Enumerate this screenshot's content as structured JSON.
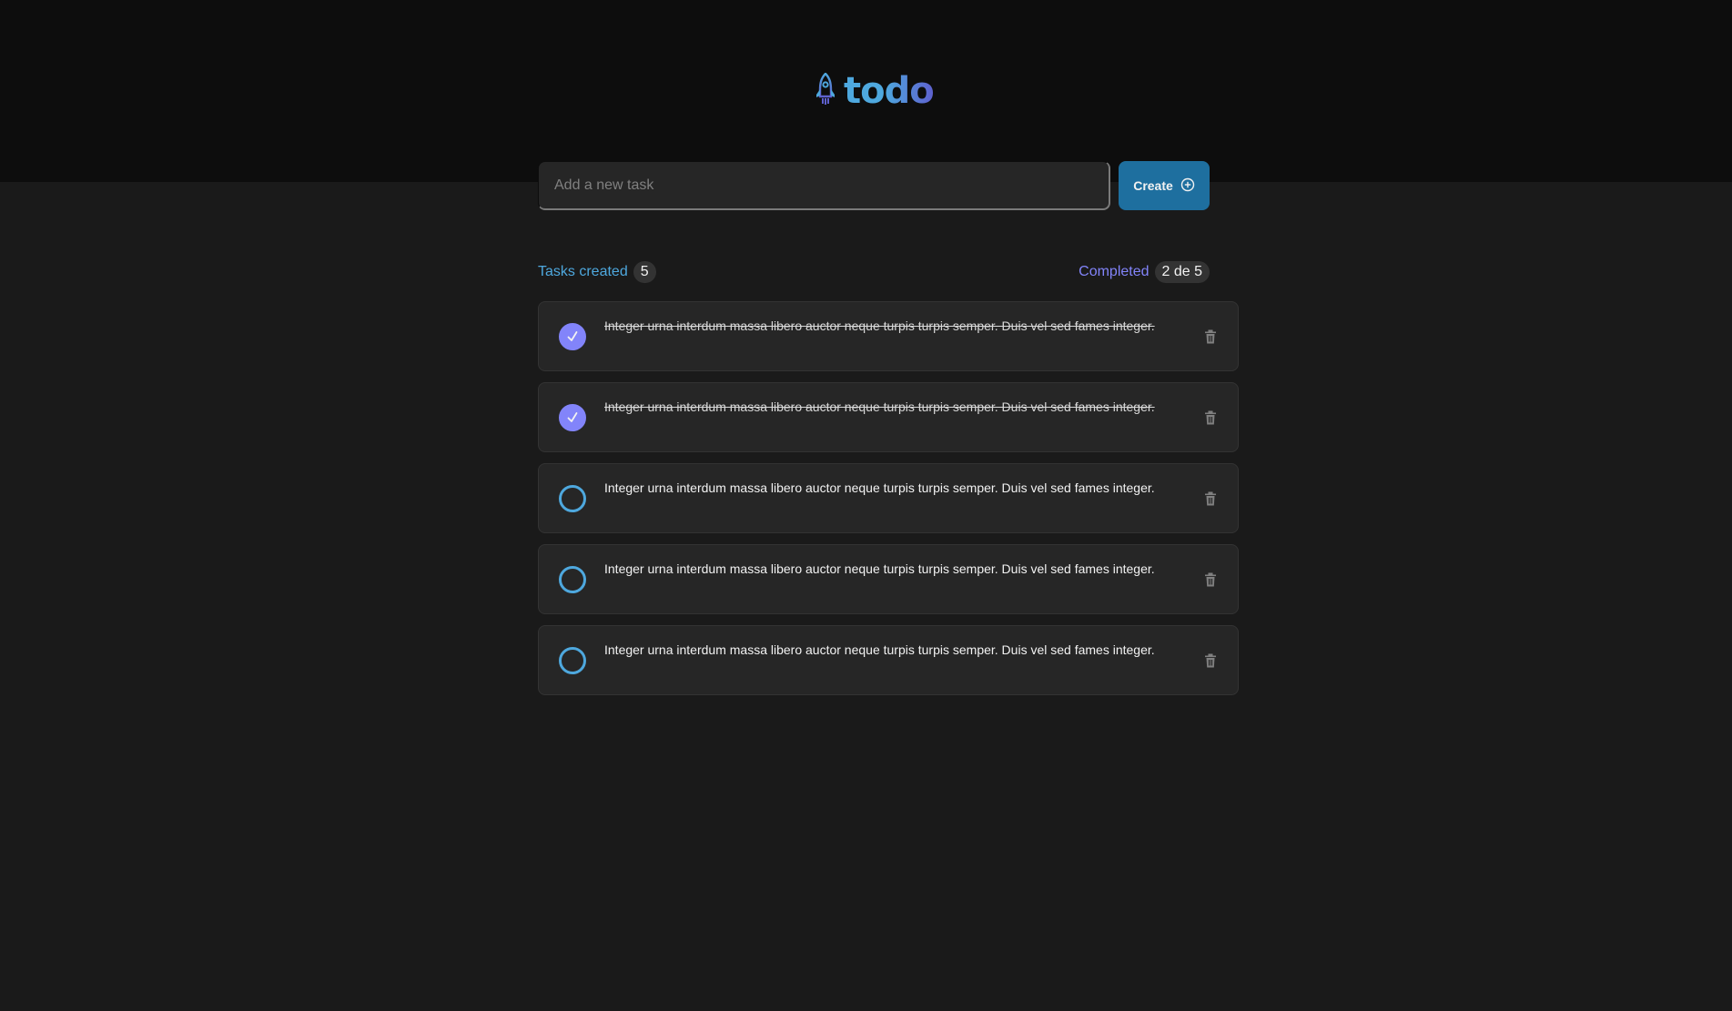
{
  "app": {
    "title": "todo",
    "logo_icon": "rocket-icon"
  },
  "new_task": {
    "placeholder": "Add a new task",
    "value": "",
    "create_label": "Create",
    "create_icon": "plus-circle-icon"
  },
  "info": {
    "created_label": "Tasks created",
    "created_count": "5",
    "completed_label": "Completed",
    "completed_count": "2 de 5"
  },
  "tasks": [
    {
      "text": "Integer urna interdum massa libero auctor neque turpis turpis semper. Duis vel sed fames integer.",
      "completed": true
    },
    {
      "text": "Integer urna interdum massa libero auctor neque turpis turpis semper. Duis vel sed fames integer.",
      "completed": true
    },
    {
      "text": "Integer urna interdum massa libero auctor neque turpis turpis semper. Duis vel sed fames integer.",
      "completed": false
    },
    {
      "text": "Integer urna interdum massa libero auctor neque turpis turpis semper. Duis vel sed fames integer.",
      "completed": false
    },
    {
      "text": "Integer urna interdum massa libero auctor neque turpis turpis semper. Duis vel sed fames integer.",
      "completed": false
    }
  ],
  "colors": {
    "background": "#1a1a1a",
    "header": "#0d0d0d",
    "blue": "#4ea8de",
    "blue_dark": "#1e6f9f",
    "purple": "#8284fa",
    "purple_dark": "#5e60ce",
    "card": "#262626",
    "counter": "#333333",
    "trash": "#808080"
  }
}
